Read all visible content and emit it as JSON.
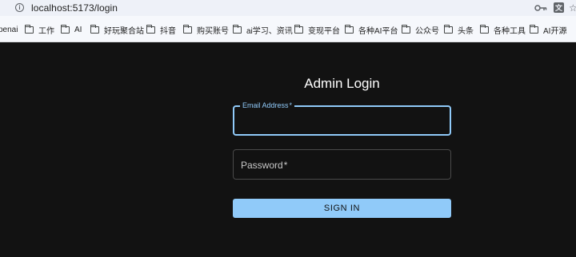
{
  "browser": {
    "url": "localhost:5173/login",
    "translate_glyph": "文",
    "star_glyph": "☆"
  },
  "bookmarks": [
    {
      "label": "penai",
      "icon": "none"
    },
    {
      "label": "工作",
      "icon": "folder-icon"
    },
    {
      "label": "AI",
      "icon": "folder-icon"
    },
    {
      "label": "好玩聚合站",
      "icon": "folder-icon"
    },
    {
      "label": "抖音",
      "icon": "folder-icon"
    },
    {
      "label": "购买账号",
      "icon": "folder-icon"
    },
    {
      "label": "ai学习、资讯",
      "icon": "folder-icon"
    },
    {
      "label": "变现平台",
      "icon": "folder-icon"
    },
    {
      "label": "各种AI平台",
      "icon": "folder-icon"
    },
    {
      "label": "公众号",
      "icon": "folder-icon"
    },
    {
      "label": "头条",
      "icon": "folder-icon"
    },
    {
      "label": "各种工具",
      "icon": "folder-icon"
    },
    {
      "label": "AI开源",
      "icon": "folder-icon"
    }
  ],
  "login": {
    "title": "Admin Login",
    "email_label": "Email Address",
    "password_label": "Password",
    "required_marker": "*",
    "signin_label": "SIGN IN"
  },
  "colors": {
    "background": "#121212",
    "accent": "#90caf9",
    "text": "#ffffff"
  }
}
